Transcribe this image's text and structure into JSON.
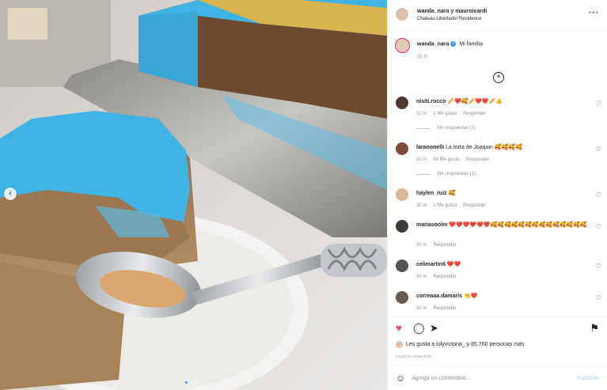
{
  "header": {
    "users": "wanda_nara y mauroicardi",
    "location": "Chateau Libertador Residence",
    "more_icon": "more-horizontal-icon"
  },
  "caption": {
    "user": "wanda_nara",
    "text": "Mi familia",
    "time": "31 m"
  },
  "comments": [
    {
      "user": "nisiti.rocco",
      "text": "🥖❤️🥰🥖❤️❤️🥖👍",
      "time": "31 m",
      "likes": "2 Me gusta",
      "reply": "Responder",
      "view_replies": "Ver respuestas (1)"
    },
    {
      "user": "laranonelli",
      "text": "La torta de Joaquin 🥰🥰🥰🥰",
      "time": "31 m",
      "likes": "93 Me gusta",
      "reply": "Responder",
      "view_replies": "Ver respuestas (1)"
    },
    {
      "user": "haylen_ruiz",
      "text": "🥰",
      "time": "30 m",
      "likes": "2 Me gusta",
      "reply": "Responder"
    },
    {
      "user": "mariasoolm",
      "text": "❤️❤️❤️❤️❤️❤️🥰🥰🥰🥰🥰🥰🥰🥰🥰🥰🥰🥰🥰🥰",
      "time": "30 m",
      "reply": "Responder"
    },
    {
      "user": "celimartin6",
      "text": "❤️❤️",
      "time": "30 m",
      "reply": "Responder"
    },
    {
      "user": "correaaa.damaris",
      "text": "👏❤️",
      "time": "30 m",
      "reply": "Responder"
    }
  ],
  "likes_text": "Les gusta a lolyvictoria_ y 85.760 personas más",
  "date": "HACE 31 MINUTOS",
  "add_comment": {
    "placeholder": "Agrega un comentario...",
    "post_label": "Publicar"
  },
  "colors": {
    "accent": "#3897f0",
    "like_red": "#ed4956",
    "frosting": "#3fb4e4"
  }
}
